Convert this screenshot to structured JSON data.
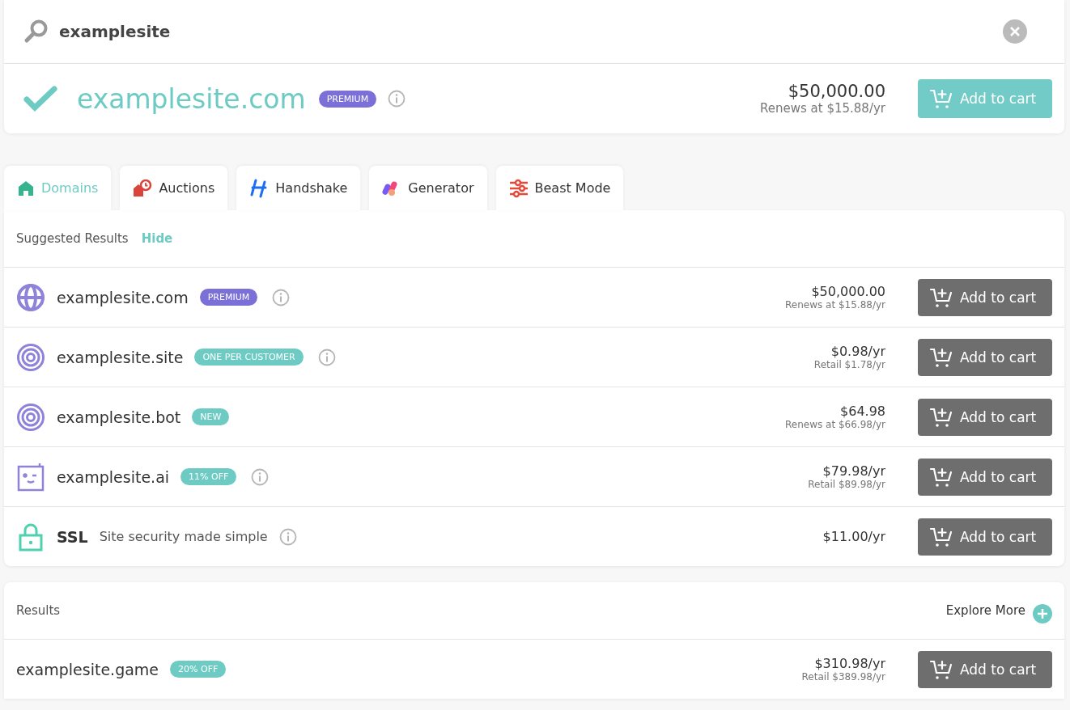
{
  "search": {
    "value": "examplesite"
  },
  "featured": {
    "domain": "examplesite.com",
    "badge": {
      "label": "PREMIUM",
      "color": "#7b6fd8"
    },
    "info": true,
    "price": "$50,000.00",
    "subprice": "Renews at $15.88/yr",
    "button": "Add to cart"
  },
  "tabs": [
    {
      "label": "Domains",
      "selected": true,
      "kind": "house"
    },
    {
      "label": "Auctions",
      "selected": false,
      "kind": "auction"
    },
    {
      "label": "Handshake",
      "selected": false,
      "kind": "handshake"
    },
    {
      "label": "Generator",
      "selected": false,
      "kind": "generator"
    },
    {
      "label": "Beast Mode",
      "selected": false,
      "kind": "sliders"
    }
  ],
  "suggested": {
    "title": "Suggested Results",
    "hide_link": "Hide",
    "rows": [
      {
        "kind": "globe",
        "name": "examplesite.com",
        "badge": {
          "label": "PREMIUM",
          "color": "#7b6fd8"
        },
        "info": true,
        "price": "$50,000.00",
        "subprice": "Renews at $15.88/yr",
        "button": "Add to cart"
      },
      {
        "kind": "target",
        "name": "examplesite.site",
        "badge": {
          "label": "ONE PER CUSTOMER",
          "color": "#6ecbc4"
        },
        "info": true,
        "price": "$0.98/yr",
        "subprice": "Retail $1.78/yr",
        "button": "Add to cart"
      },
      {
        "kind": "target",
        "name": "examplesite.bot",
        "badge": {
          "label": "NEW",
          "color": "#6ecbc4"
        },
        "info": false,
        "price": "$64.98",
        "subprice": "Renews at $66.98/yr",
        "button": "Add to cart"
      },
      {
        "kind": "robot",
        "name": "examplesite.ai",
        "badge": {
          "label": "11% OFF",
          "color": "#6ecbc4"
        },
        "info": true,
        "price": "$79.98/yr",
        "subprice": "Retail $89.98/yr",
        "button": "Add to cart"
      },
      {
        "kind": "lock",
        "name": "SSL",
        "description": "Site security made simple",
        "info": true,
        "price": "$11.00/yr",
        "button": "Add to cart"
      }
    ]
  },
  "results": {
    "title": "Results",
    "explore": "Explore More",
    "rows": [
      {
        "name": "examplesite.game",
        "badge": {
          "label": "20% OFF",
          "color": "#6ecbc4"
        },
        "info": false,
        "price": "$310.98/yr",
        "subprice": "Retail $389.98/yr",
        "button": "Add to cart"
      }
    ]
  }
}
